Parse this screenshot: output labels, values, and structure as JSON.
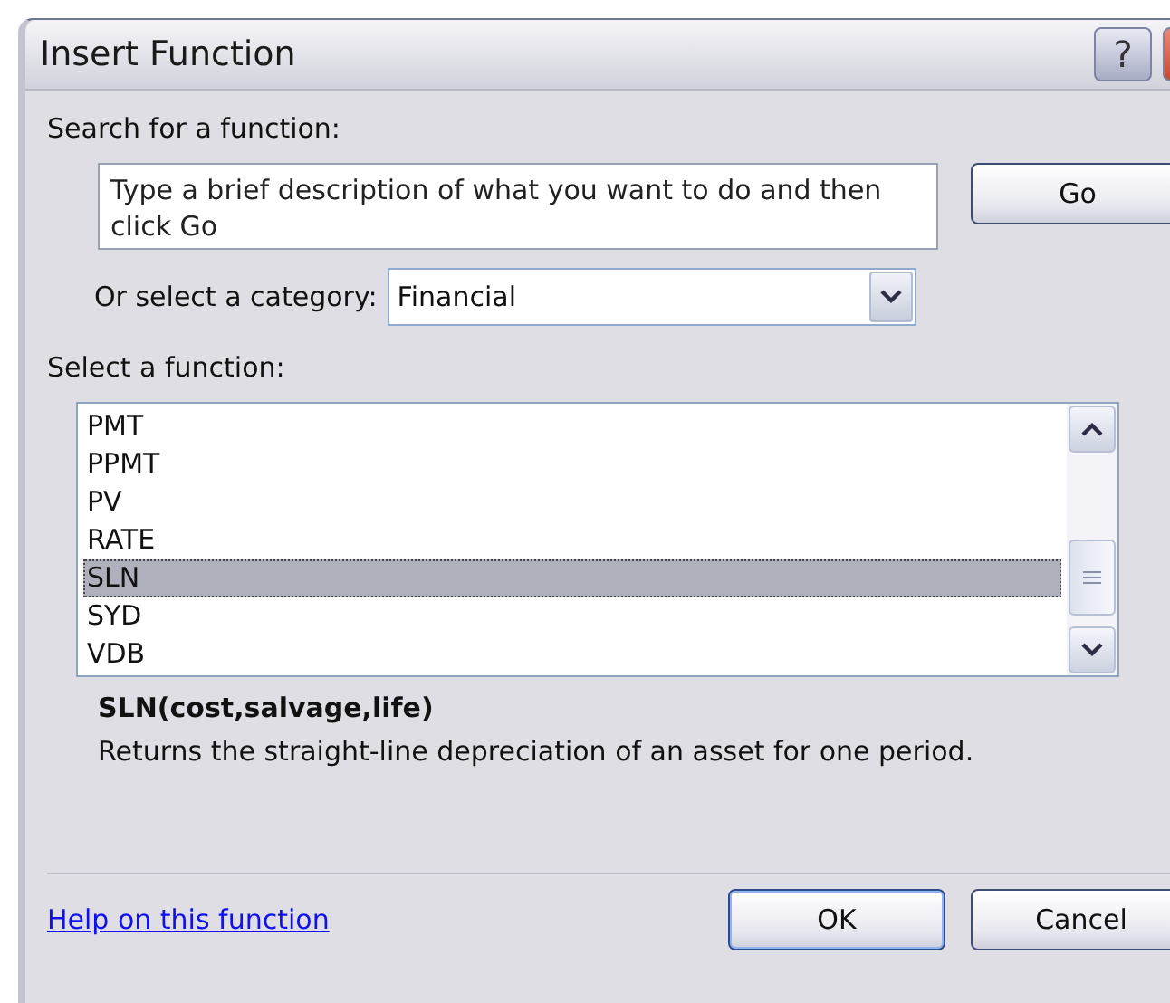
{
  "window": {
    "title": "Insert Function",
    "help_label": "?"
  },
  "search": {
    "label": "Search for a function:",
    "value": "Type a brief description of what you want to do and then click Go",
    "button": "Go"
  },
  "category": {
    "label": "Or select a category:",
    "value": "Financial"
  },
  "functions": {
    "label": "Select a function:",
    "items": [
      {
        "name": "PMT",
        "selected": false
      },
      {
        "name": "PPMT",
        "selected": false
      },
      {
        "name": "PV",
        "selected": false
      },
      {
        "name": "RATE",
        "selected": false
      },
      {
        "name": "SLN",
        "selected": true
      },
      {
        "name": "SYD",
        "selected": false
      },
      {
        "name": "VDB",
        "selected": false
      }
    ]
  },
  "signature": "SLN(cost,salvage,life)",
  "description": "Returns the straight-line depreciation of an asset for one period.",
  "help_link": "Help on this function",
  "buttons": [
    {
      "label": "OK",
      "kind": "default"
    },
    {
      "label": "Cancel",
      "kind": "normal"
    }
  ]
}
